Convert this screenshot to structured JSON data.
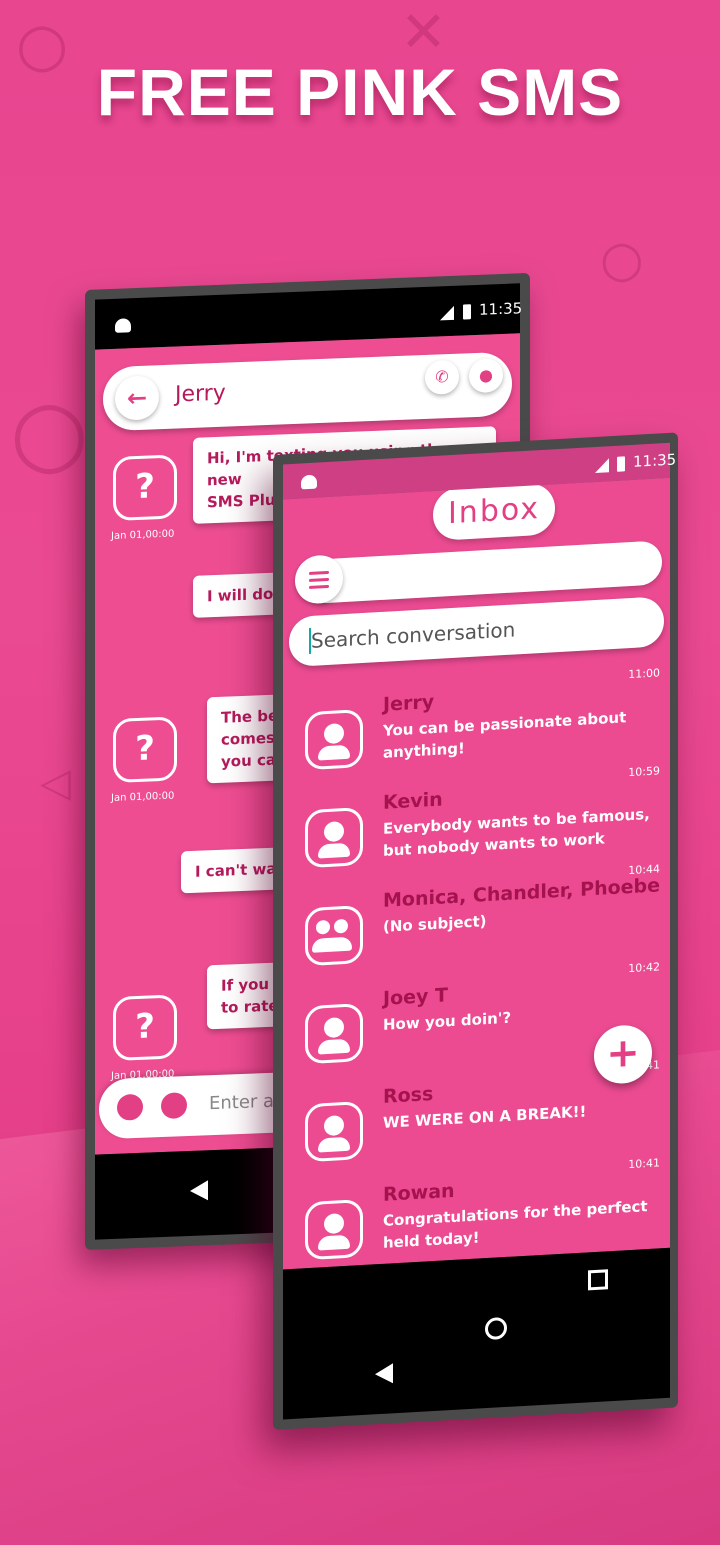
{
  "headline": "FREE PINK SMS",
  "status_time": "11:35",
  "chat": {
    "contact_name": "Jerry",
    "message_timestamp": "Jan 01,00:00",
    "messages": [
      "Hi, I'm texting you using the new\nSMS Plus app and it's fantastic!",
      "I will do",
      "The be\ncomes\nyou ca",
      "I can't wa",
      "If you l\nto rate"
    ],
    "input_placeholder": "Enter a"
  },
  "inbox": {
    "title": "Inbox",
    "search_placeholder": "Search conversation",
    "conversations": [
      {
        "name": "Jerry",
        "message": "You can be passionate about anything!",
        "time": "11:00",
        "avatar": "person-icon"
      },
      {
        "name": "Kevin",
        "message": "Everybody wants to be famous, but nobody wants to work",
        "time": "10:59",
        "avatar": "person-icon"
      },
      {
        "name": "Monica, Chandler, Phoebe",
        "message": "(No subject)",
        "time": "10:44",
        "avatar": "group-icon"
      },
      {
        "name": "Joey T",
        "message": "How you doin'?",
        "time": "10:42",
        "avatar": "person-icon"
      },
      {
        "name": "Ross",
        "message": "WE WERE ON A BREAK!!",
        "time": "10:41",
        "avatar": "person-icon"
      },
      {
        "name": "Rowan",
        "message": "Congratulations for the perfect held today!",
        "time": "10:41",
        "avatar": "person-icon"
      }
    ],
    "fab_label": "+"
  },
  "colors": {
    "accent": "#e33f84",
    "name_text": "#a5134f",
    "background": "#ea4a92"
  }
}
